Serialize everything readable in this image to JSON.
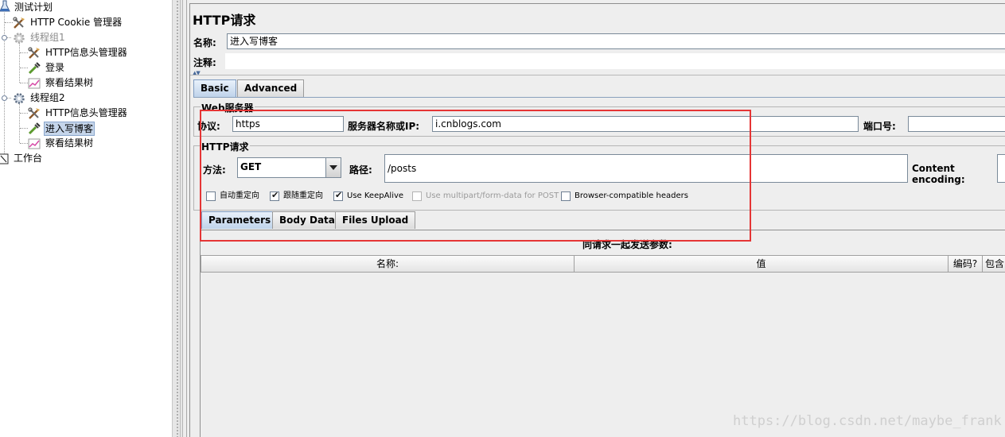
{
  "tree": {
    "root": "测试计划",
    "cookie_manager": "HTTP Cookie 管理器",
    "thread_group_1": "线程组1",
    "tg1_header_manager": "HTTP信息头管理器",
    "tg1_login": "登录",
    "tg1_results_tree": "察看结果树",
    "thread_group_2": "线程组2",
    "tg2_header_manager": "HTTP信息头管理器",
    "tg2_enter_blog": "进入写博客",
    "tg2_results_tree": "察看结果树",
    "workbench": "工作台"
  },
  "panel": {
    "title": "HTTP请求",
    "name_label": "名称:",
    "name_value": "进入写博客",
    "comment_label": "注释:",
    "comment_value": ""
  },
  "tabs": {
    "basic": "Basic",
    "advanced": "Advanced"
  },
  "web_server": {
    "group_title": "Web服务器",
    "protocol_label": "协议:",
    "protocol_value": "https",
    "server_label": "服务器名称或IP:",
    "server_value": "i.cnblogs.com",
    "port_label": "端口号:",
    "port_value": ""
  },
  "http_request": {
    "group_title": "HTTP请求",
    "method_label": "方法:",
    "method_value": "GET",
    "path_label": "路径:",
    "path_value": "/posts",
    "encoding_label": "Content encoding:"
  },
  "options": {
    "auto_redirect": {
      "label": "自动重定向",
      "checked": false
    },
    "follow_redirect": {
      "label": "跟随重定向",
      "checked": true
    },
    "keepalive": {
      "label": "Use KeepAlive",
      "checked": true
    },
    "multipart": {
      "label": "Use multipart/form-data for POST",
      "checked": false
    },
    "browser_headers": {
      "label": "Browser-compatible headers",
      "checked": false
    }
  },
  "sub_tabs": {
    "parameters": "Parameters",
    "body_data": "Body Data",
    "files_upload": "Files Upload"
  },
  "params": {
    "caption": "同请求一起发送参数:",
    "columns": [
      "名称:",
      "值",
      "编码?",
      "包含"
    ]
  },
  "watermark": "https://blog.csdn.net/maybe_frank",
  "colors": {
    "annotation": "#e53535",
    "active_tab": "#bfd3ea"
  }
}
